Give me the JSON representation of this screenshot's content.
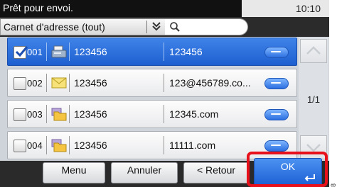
{
  "status": {
    "message": "Prêt pour envoi.",
    "time": "10:10"
  },
  "filter": {
    "selected": "Carnet d'adresse (tout)",
    "search_placeholder": ""
  },
  "rows": [
    {
      "num": "001",
      "name": "123456",
      "address": "123456",
      "type": "fax",
      "checked": true
    },
    {
      "num": "002",
      "name": "123456",
      "address": "123@456789.co...",
      "type": "email",
      "checked": false
    },
    {
      "num": "003",
      "name": "123456",
      "address": "12345.com",
      "type": "folder",
      "checked": false
    },
    {
      "num": "004",
      "name": "123456",
      "address": "11111.com",
      "type": "folder",
      "checked": false
    }
  ],
  "page_indicator": "1/1",
  "buttons": {
    "menu": "Menu",
    "cancel": "Annuler",
    "back": "< Retour",
    "ok": "OK"
  },
  "side_code": "8"
}
